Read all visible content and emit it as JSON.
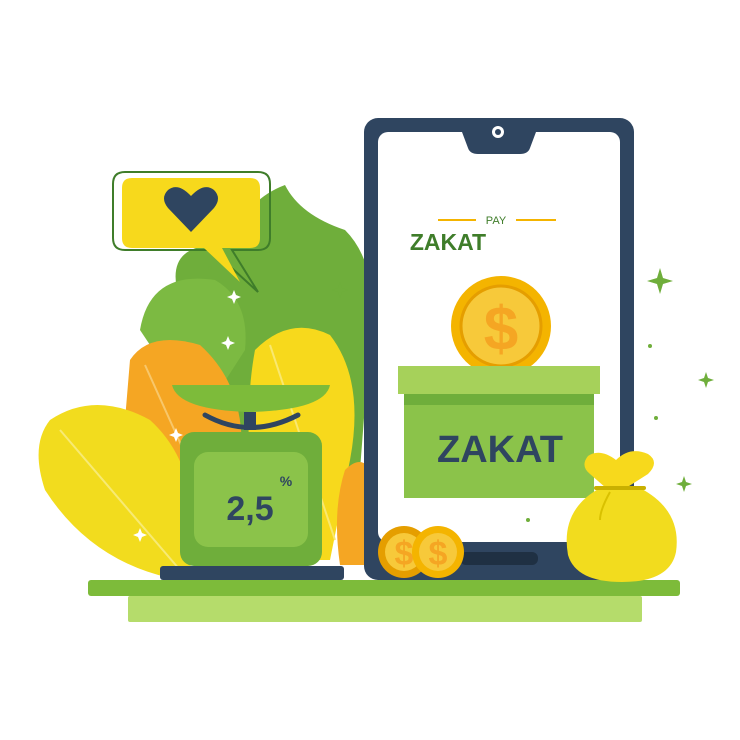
{
  "phone": {
    "pay_label": "PAY",
    "title": "ZAKAT"
  },
  "donation_box": {
    "label": "ZAKAT"
  },
  "scale": {
    "value": "2,5",
    "unit": "%"
  },
  "coin_symbol": "$",
  "icons": {
    "speech_bubble": "heart-icon",
    "coin": "dollar-coin-icon",
    "bag": "money-bag-icon",
    "sparkle": "sparkle-icon"
  },
  "colors": {
    "light_green": "#95c93d",
    "dark_green": "#3f7d2a",
    "yellow": "#f7d91c",
    "gold": "#f4b400",
    "orange": "#f5a623",
    "navy": "#2f4560"
  }
}
